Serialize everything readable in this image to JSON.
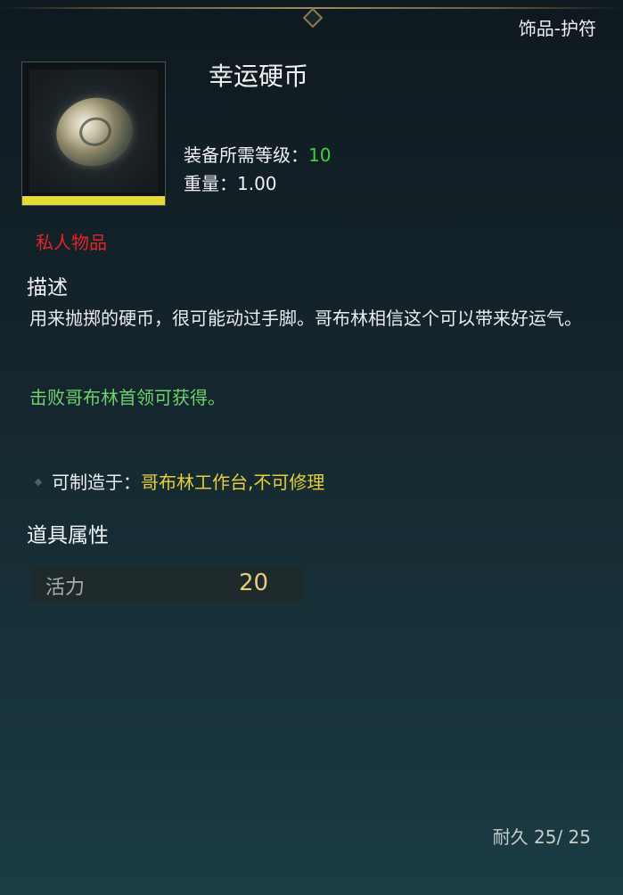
{
  "category": "饰品-护符",
  "item": {
    "name": "幸运硬币",
    "icon": "lucky-coin-icon",
    "rarity_color": "#e3db3a",
    "required_level_label": "装备所需等级：",
    "required_level": "10",
    "weight_label": "重量：",
    "weight": "1.00",
    "private_tag": "私人物品"
  },
  "description": {
    "title": "描述",
    "text": "用来抛掷的硬币，很可能动过手脚。哥布林相信这个可以带来好运气。",
    "source": "击败哥布林首领可获得。"
  },
  "craft": {
    "label": "可制造于：",
    "value": "哥布林工作台,不可修理"
  },
  "properties": {
    "title": "道具属性",
    "stats": [
      {
        "name": "活力",
        "value": "20"
      }
    ]
  },
  "durability": {
    "label": "耐久",
    "current": "25/",
    "max": "25"
  },
  "colors": {
    "level_green": "#3fd23f",
    "private_red": "#e0262a",
    "source_green": "#6ed26b",
    "craft_yellow": "#e7cf3b",
    "stat_value": "#e6cd7c"
  }
}
